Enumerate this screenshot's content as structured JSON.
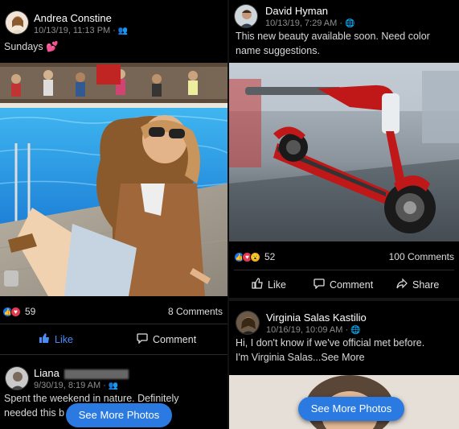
{
  "left_post1": {
    "author": "Andrea Constine",
    "meta": "10/13/19, 11:13 PM ·",
    "caption": "Sundays 💕",
    "reaction_count": "59",
    "comments": "8 Comments",
    "like_label": "Like",
    "comment_label": "Comment"
  },
  "left_post2": {
    "author": "Liana",
    "meta": "9/30/19, 8:19 AM ·",
    "caption_line1": "Spent the weekend in nature. Definitely",
    "caption_line2": "needed this b",
    "see_more": "See More Photos"
  },
  "right_post1": {
    "author": "David Hyman",
    "meta": "10/13/19, 7:29 AM ·",
    "caption_line1": "This new beauty available soon. Need color",
    "caption_line2": "name suggestions.",
    "reaction_count": "52",
    "comments": "100 Comments",
    "like_label": "Like",
    "comment_label": "Comment",
    "share_label": "Share"
  },
  "right_post2": {
    "author": "Virginia Salas Kastilio",
    "meta": "10/16/19, 10:09 AM ·",
    "caption_line1": "Hi, I don't know if we've official met before.",
    "caption_line2": "I'm Virginia Salas...See More",
    "see_more": "See More Photos"
  }
}
